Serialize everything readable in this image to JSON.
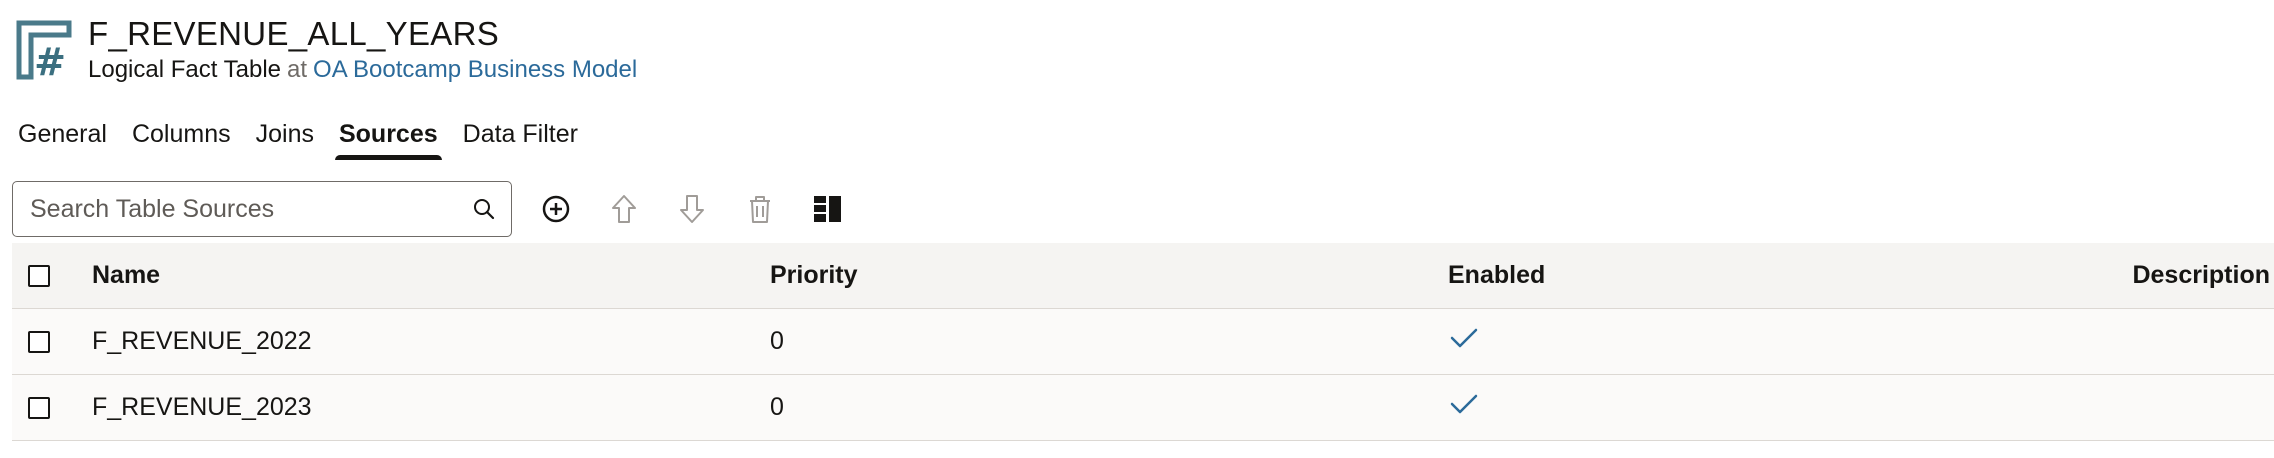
{
  "header": {
    "title": "F_REVENUE_ALL_YEARS",
    "subtitle_type": "Logical Fact Table",
    "subtitle_at": "at",
    "model_link": "OA Bootcamp Business Model",
    "icon": "logical-fact-table-icon"
  },
  "tabs": [
    {
      "label": "General",
      "active": false
    },
    {
      "label": "Columns",
      "active": false
    },
    {
      "label": "Joins",
      "active": false
    },
    {
      "label": "Sources",
      "active": true
    },
    {
      "label": "Data Filter",
      "active": false
    }
  ],
  "toolbar": {
    "search_placeholder": "Search Table Sources",
    "search_value": "",
    "icons": [
      "add-icon",
      "move-up-icon",
      "move-down-icon",
      "delete-icon",
      "column-layout-icon"
    ]
  },
  "grid": {
    "columns": [
      "Name",
      "Priority",
      "Enabled",
      "Description"
    ],
    "rows": [
      {
        "name": "F_REVENUE_2022",
        "priority": "0",
        "enabled": true,
        "description": ""
      },
      {
        "name": "F_REVENUE_2023",
        "priority": "0",
        "enabled": true,
        "description": ""
      }
    ]
  },
  "colors": {
    "link": "#2b6a9a",
    "icon_teal": "#3b6f80",
    "check": "#2b6a9a",
    "disabled_icon": "#a09c98",
    "header_bg": "#f5f4f2"
  }
}
